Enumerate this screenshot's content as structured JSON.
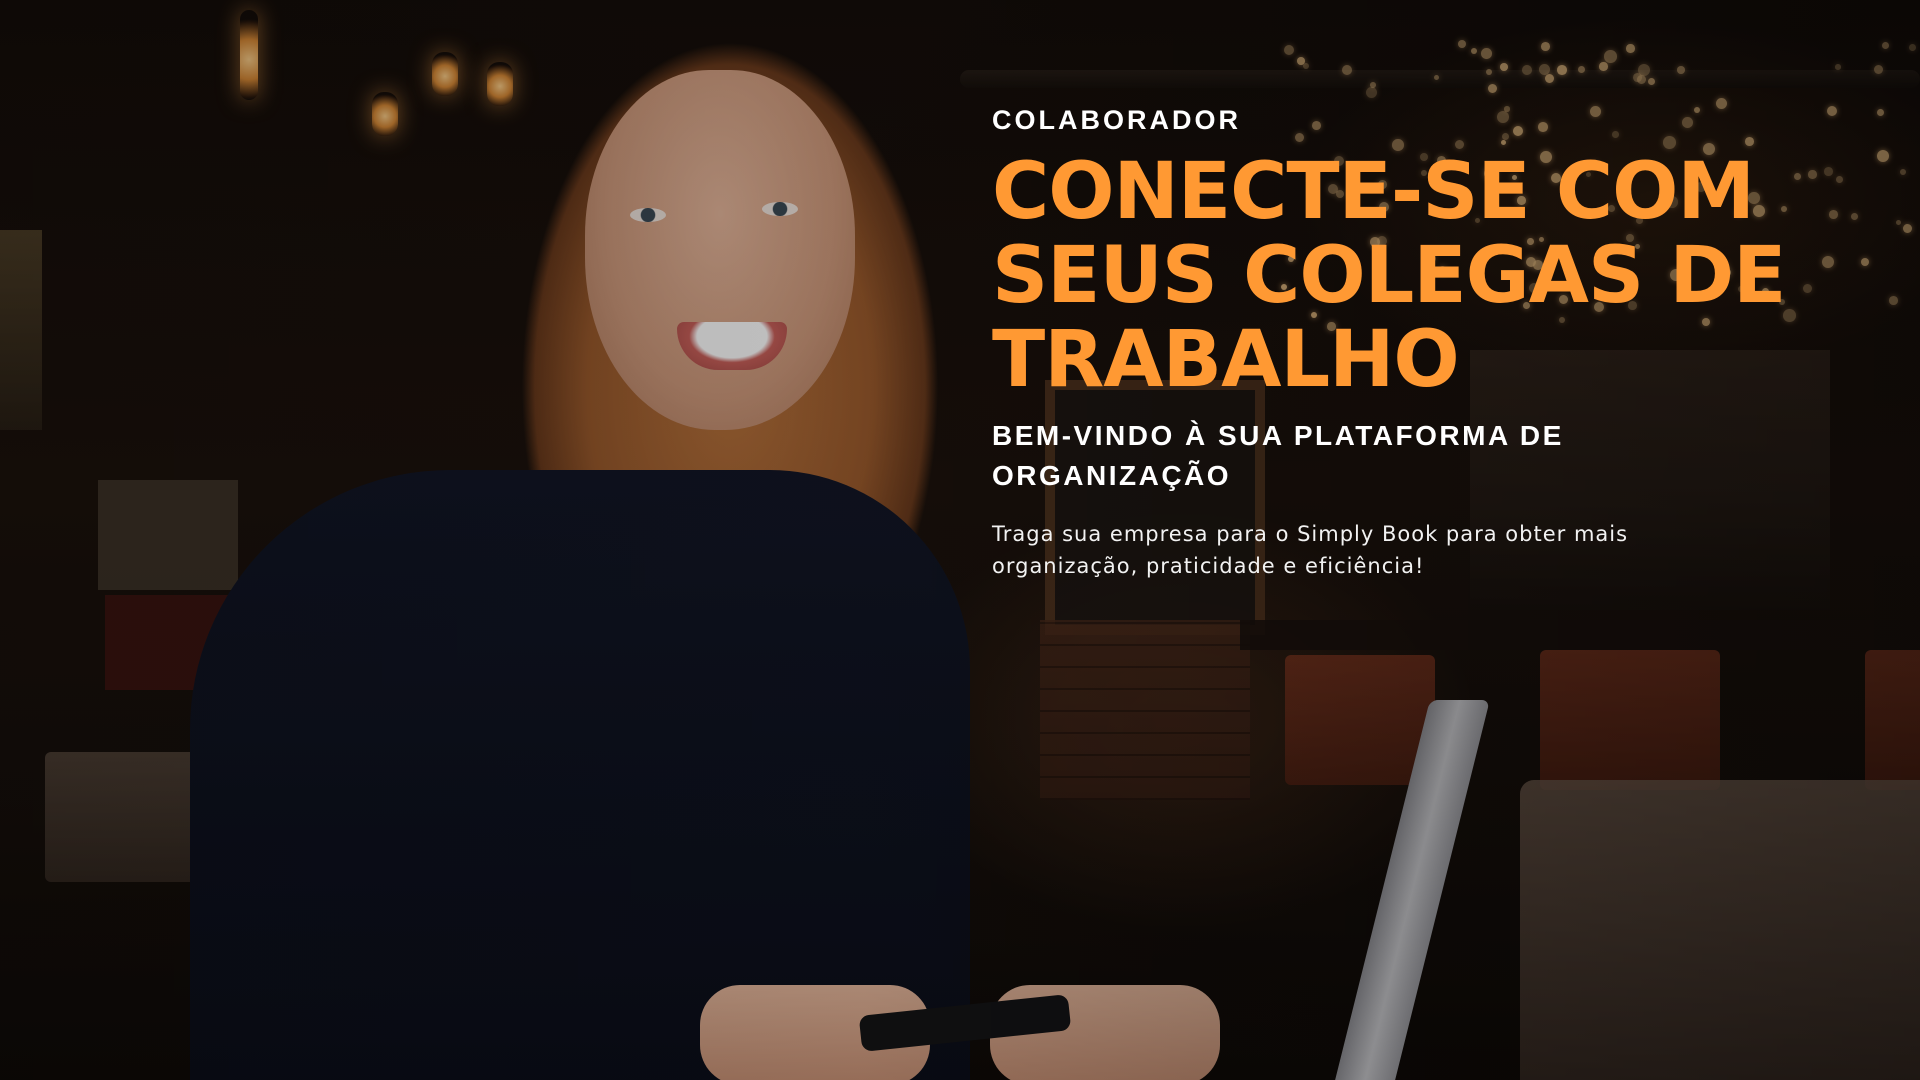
{
  "hero": {
    "eyebrow": "COLABORADOR",
    "headline": "CONECTE-SE COM SEUS COLEGAS DE TRABALHO",
    "subheading": "BEM-VINDO À SUA PLATAFORMA DE ORGANIZAÇÃO",
    "description": "Traga sua empresa para o Simply Book para obter mais organização, praticidade e eficiência!",
    "accent_color": "#ff9933",
    "text_color": "#ffffff"
  }
}
